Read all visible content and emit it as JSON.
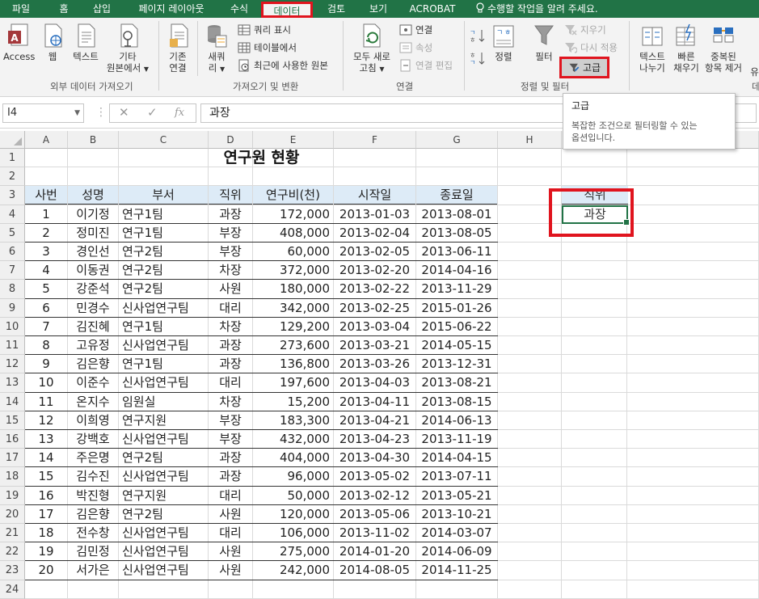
{
  "ribbon_tabs": [
    {
      "label": "파일"
    },
    {
      "label": "홈"
    },
    {
      "label": "삽입"
    },
    {
      "label": "페이지 레이아웃"
    },
    {
      "label": "수식"
    },
    {
      "label": "데이터",
      "active": true
    },
    {
      "label": "검토"
    },
    {
      "label": "보기"
    },
    {
      "label": "ACROBAT"
    },
    {
      "label": "수행할 작업을 알려 주세요."
    }
  ],
  "ribbon": {
    "external": {
      "access": "Access",
      "web": "웹",
      "text": "텍스트",
      "other_line1": "기타",
      "other_line2": "원본에서",
      "group_label": "외부 데이터 가져오기"
    },
    "get_transform": {
      "existing_line1": "기존",
      "existing_line2": "연결",
      "new_line1": "새쿼",
      "new_line2": "리",
      "show_queries": "쿼리 표시",
      "from_table": "테이블에서",
      "recent_sources": "최근에 사용한 원본",
      "group_label": "가져오기 및 변환"
    },
    "connections": {
      "refresh_line1": "모두 새로",
      "refresh_line2": "고침",
      "connections": "연결",
      "properties": "속성",
      "edit_links": "연결 편집",
      "group_label": "연결"
    },
    "sort_filter": {
      "sort": "정렬",
      "filter": "필터",
      "clear": "지우기",
      "reapply": "다시 적용",
      "advanced": "고급",
      "group_label": "정렬 및 필터"
    },
    "data_tools": {
      "text_to_columns_line1": "텍스트",
      "text_to_columns_line2": "나누기",
      "flash_fill_line1": "빠른",
      "flash_fill_line2": "채우기",
      "remove_dup_line1": "중복된",
      "remove_dup_line2": "항목 제거",
      "validation_partial": "유",
      "group_label_partial": "데"
    }
  },
  "tooltip": {
    "title": "고급",
    "desc_line1": "복잡한 조건으로 필터링할 수 있는",
    "desc_line2": "옵션입니다."
  },
  "formula_bar": {
    "name_box": "I4",
    "formula": "과장"
  },
  "columns": [
    "A",
    "B",
    "C",
    "D",
    "E",
    "F",
    "G",
    "H",
    "I",
    "J"
  ],
  "rows": [
    "1",
    "2",
    "3",
    "4",
    "5",
    "6",
    "7",
    "8",
    "9",
    "10",
    "11",
    "12",
    "13",
    "14",
    "15",
    "16",
    "17",
    "18",
    "19",
    "20",
    "21",
    "22",
    "23",
    "24"
  ],
  "sheet": {
    "title": "연구원 현황",
    "headers": [
      "사번",
      "성명",
      "부서",
      "직위",
      "연구비(천)",
      "시작일",
      "종료일"
    ],
    "records": [
      [
        "1",
        "이기정",
        "연구1팀",
        "과장",
        "172,000",
        "2013-01-03",
        "2013-08-01"
      ],
      [
        "2",
        "정미진",
        "연구1팀",
        "부장",
        "408,000",
        "2013-02-04",
        "2013-08-05"
      ],
      [
        "3",
        "경인선",
        "연구2팀",
        "부장",
        "60,000",
        "2013-02-05",
        "2013-06-11"
      ],
      [
        "4",
        "이동권",
        "연구2팀",
        "차장",
        "372,000",
        "2013-02-20",
        "2014-04-16"
      ],
      [
        "5",
        "강준석",
        "연구2팀",
        "사원",
        "180,000",
        "2013-02-22",
        "2013-11-29"
      ],
      [
        "6",
        "민경수",
        "신사업연구팀",
        "대리",
        "342,000",
        "2013-02-25",
        "2015-01-26"
      ],
      [
        "7",
        "김진혜",
        "연구1팀",
        "차장",
        "129,200",
        "2013-03-04",
        "2015-06-22"
      ],
      [
        "8",
        "고유정",
        "신사업연구팀",
        "과장",
        "273,600",
        "2013-03-21",
        "2014-05-15"
      ],
      [
        "9",
        "김은향",
        "연구1팀",
        "과장",
        "136,800",
        "2013-03-26",
        "2013-12-31"
      ],
      [
        "10",
        "이준수",
        "신사업연구팀",
        "대리",
        "197,600",
        "2013-04-03",
        "2013-08-21"
      ],
      [
        "11",
        "온지수",
        "임원실",
        "차장",
        "15,200",
        "2013-04-11",
        "2013-08-15"
      ],
      [
        "12",
        "이희영",
        "연구지원",
        "부장",
        "183,300",
        "2013-04-21",
        "2014-06-13"
      ],
      [
        "13",
        "강백호",
        "신사업연구팀",
        "부장",
        "432,000",
        "2013-04-23",
        "2013-11-19"
      ],
      [
        "14",
        "주은명",
        "연구2팀",
        "과장",
        "404,000",
        "2013-04-30",
        "2014-04-15"
      ],
      [
        "15",
        "김수진",
        "신사업연구팀",
        "과장",
        "96,000",
        "2013-05-02",
        "2013-07-11"
      ],
      [
        "16",
        "박진형",
        "연구지원",
        "대리",
        "50,000",
        "2013-02-12",
        "2013-05-21"
      ],
      [
        "17",
        "김은향",
        "연구2팀",
        "사원",
        "120,000",
        "2013-05-06",
        "2013-10-21"
      ],
      [
        "18",
        "전수창",
        "신사업연구팀",
        "대리",
        "106,000",
        "2013-11-02",
        "2014-03-07"
      ],
      [
        "19",
        "김민정",
        "신사업연구팀",
        "사원",
        "275,000",
        "2014-01-20",
        "2014-06-09"
      ],
      [
        "20",
        "서가은",
        "신사업연구팀",
        "사원",
        "242,000",
        "2014-08-05",
        "2014-11-25"
      ]
    ],
    "criteria": {
      "header": "직위",
      "value": "과장"
    }
  },
  "colors": {
    "ribbon_green": "#217346",
    "highlight_red": "#e0141e",
    "header_fill": "#ddebf7"
  }
}
